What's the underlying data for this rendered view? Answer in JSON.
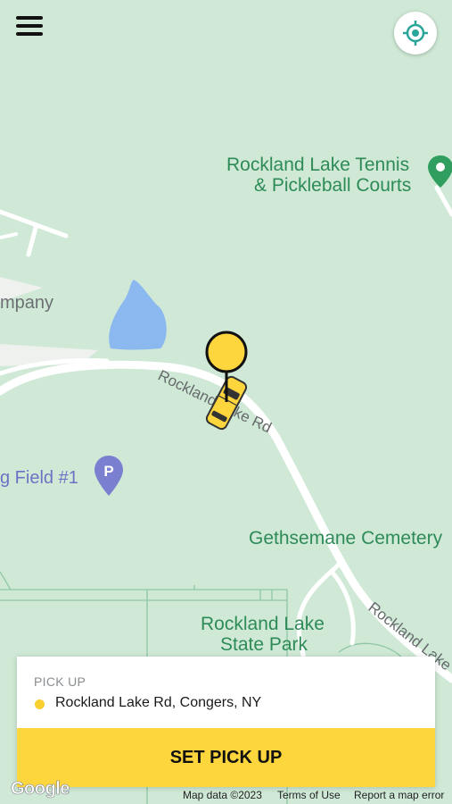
{
  "header": {
    "menu_icon": "hamburger-menu-icon",
    "locate_icon": "crosshair-location-icon"
  },
  "map": {
    "labels": {
      "tennis_line1": "Rockland Lake Tennis",
      "tennis_line2": "& Pickleball Courts",
      "company": "mpany",
      "field": "g Field #1",
      "road_1": "Rockland Lake Rd",
      "road_2": "Rockland Lake",
      "cemetery": "Gethsemane Cemetery",
      "park_line1": "Rockland Lake",
      "park_line2": "State Park"
    },
    "colors": {
      "land": "#cfe9d6",
      "water": "#8cb8f0",
      "road": "#ffffff",
      "poi_green": "#2e8b57",
      "parking_purple": "#7b7fd0",
      "taxi": "#fdd53c"
    },
    "icons": [
      "green-map-pin-icon",
      "parking-icon",
      "taxi-car-icon",
      "pickup-pin-icon"
    ]
  },
  "pickup_card": {
    "label": "PICK UP",
    "address": "Rockland Lake Rd, Congers, NY",
    "button": "SET PICK UP"
  },
  "attribution": {
    "logo": "Google",
    "map_data": "Map data ©2023",
    "terms": "Terms of Use",
    "report": "Report a map error"
  }
}
